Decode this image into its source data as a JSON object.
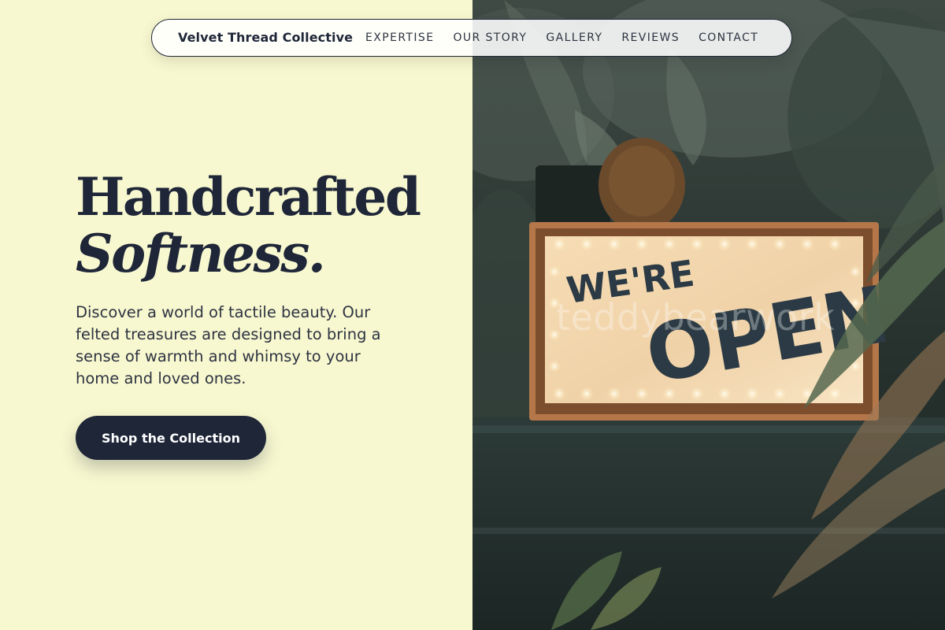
{
  "nav": {
    "brand": "Velvet Thread Collective",
    "links": [
      {
        "label": "EXPERTISE"
      },
      {
        "label": "OUR STORY"
      },
      {
        "label": "GALLERY"
      },
      {
        "label": "REVIEWS"
      },
      {
        "label": "CONTACT"
      }
    ]
  },
  "hero": {
    "title_line1": "Handcrafted",
    "title_line2": "Softness.",
    "description": "Discover a world of tactile beauty. Our felted treasures are designed to bring a sense of warmth and whimsy to your home and loved ones.",
    "cta_label": "Shop the Collection"
  },
  "image": {
    "sign_line1": "WE'RE",
    "sign_line2": "OPEN",
    "watermark": "teddybearwork"
  },
  "colors": {
    "left_background": "#f8f8d0",
    "primary_dark": "#1e2638",
    "sign_frame": "#b5774a",
    "sign_face": "#f3d6ae"
  }
}
